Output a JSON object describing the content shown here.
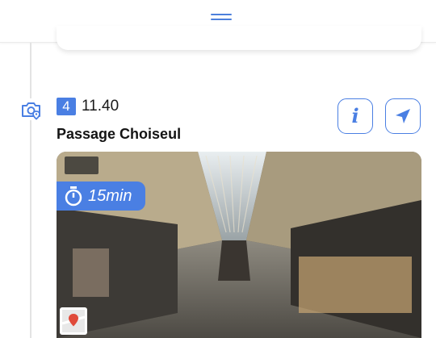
{
  "stop": {
    "number": "4",
    "time": "11.40",
    "name": "Passage Choiseul",
    "duration": "15min"
  },
  "icons": {
    "handle": "drag-handle-icon",
    "stop_type": "camera-location-icon",
    "info": "info-icon",
    "navigate": "navigation-arrow-icon",
    "timer": "stopwatch-icon",
    "map": "map-thumbnail-icon"
  },
  "buttons": {
    "info_glyph": "i"
  },
  "colors": {
    "accent": "#4a7fe3",
    "text": "#141414",
    "timeline": "#e3e3e3"
  }
}
